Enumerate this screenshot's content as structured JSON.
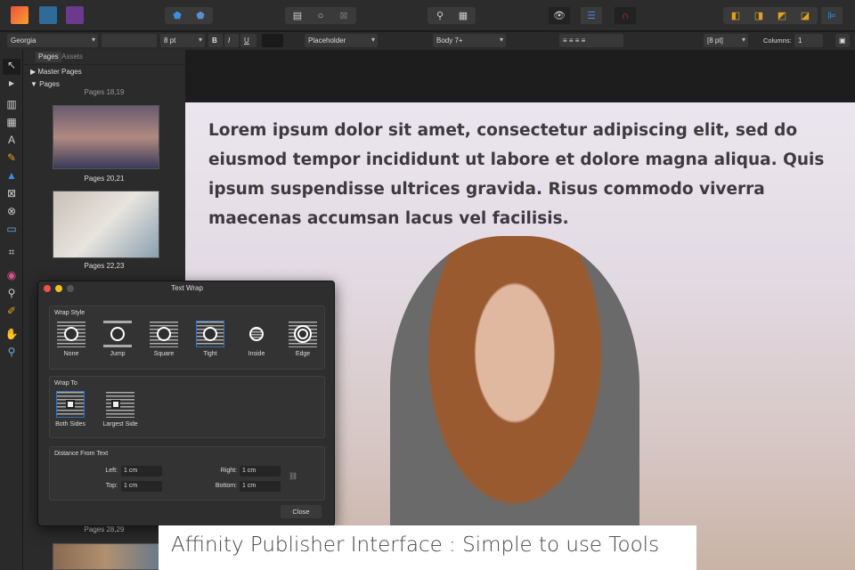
{
  "context_bar": {
    "font": "Georgia",
    "font_style": "",
    "font_size": "8 pt",
    "bold": "B",
    "italic": "I",
    "underline": "U",
    "char_style": "Placeholder",
    "para_style": "Body 7+",
    "spacing": "[8 pt]",
    "columns_label": "Columns:",
    "columns_value": "1"
  },
  "panel": {
    "tabs": [
      "Pages",
      "Assets"
    ],
    "master_pages": "Master Pages",
    "pages": "Pages",
    "page_labels": [
      "Pages 18,19",
      "Pages 20,21",
      "Pages 22,23",
      "Pages 28,29"
    ]
  },
  "body_text": "Lorem ipsum dolor sit amet, consectetur adipiscing elit, sed do eiusmod tempor incididunt ut labore et dolore magna aliqua. Quis ipsum suspendisse ultrices gravida. Risus commodo viverra maecenas accumsan lacus vel facilisis.",
  "dialog": {
    "title": "Text Wrap",
    "wrap_style_title": "Wrap Style",
    "wrap_styles": [
      "None",
      "Jump",
      "Square",
      "Tight",
      "Inside",
      "Edge"
    ],
    "selected_style": "Tight",
    "wrap_to_title": "Wrap To",
    "wrap_to": [
      "Both Sides",
      "Largest Side"
    ],
    "selected_wrap_to": "Both Sides",
    "distance_title": "Distance From Text",
    "left_label": "Left:",
    "left": "1 cm",
    "top_label": "Top:",
    "top": "1 cm",
    "right_label": "Right:",
    "right": "1 cm",
    "bottom_label": "Bottom:",
    "bottom": "1 cm",
    "close": "Close"
  },
  "caption": "Affinity Publisher Interface : Simple to use Tools"
}
